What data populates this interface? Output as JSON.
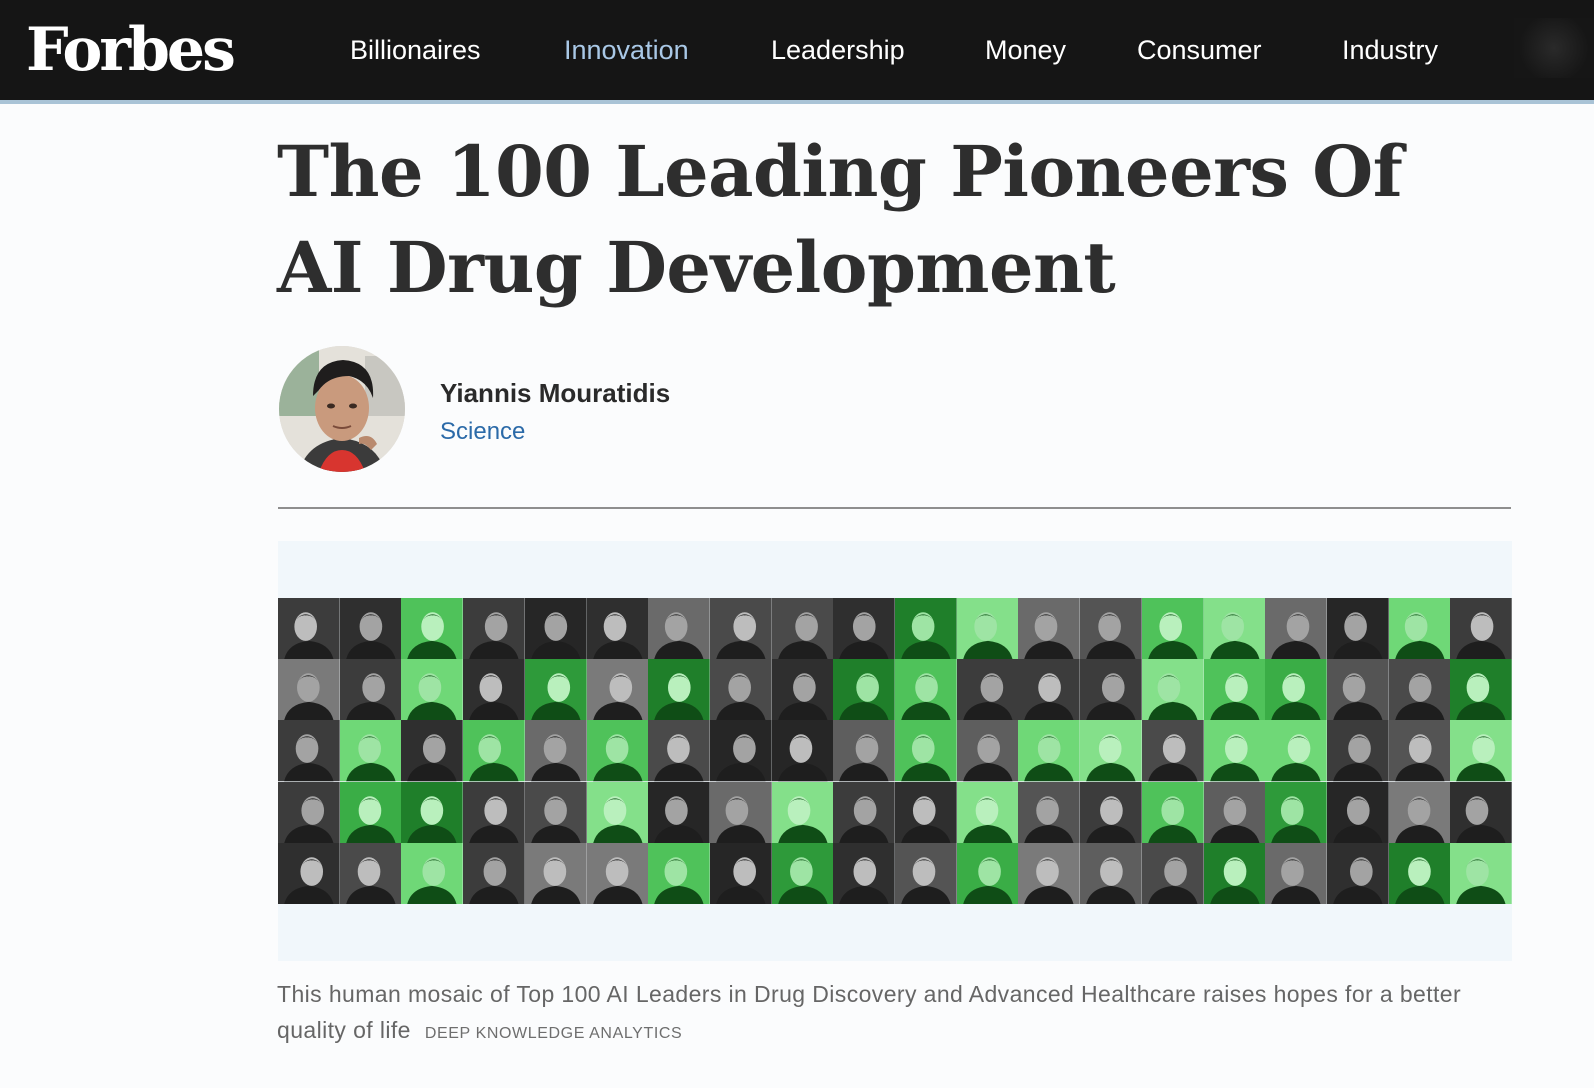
{
  "header": {
    "logo": "Forbes",
    "nav": [
      {
        "label": "Billionaires",
        "active": false
      },
      {
        "label": "Innovation",
        "active": true
      },
      {
        "label": "Leadership",
        "active": false
      },
      {
        "label": "Money",
        "active": false
      },
      {
        "label": "Consumer",
        "active": false
      },
      {
        "label": "Industry",
        "active": false
      }
    ]
  },
  "article": {
    "title": "The 100 Leading Pioneers Of AI Drug Development",
    "author": {
      "name": "Yiannis Mouratidis",
      "section": "Science"
    },
    "image": {
      "caption": "This human mosaic of Top 100 AI Leaders in Drug Discovery and Advanced Healthcare raises hopes for a better quality of life",
      "credit": "DEEP KNOWLEDGE ANALYTICS"
    }
  },
  "colors": {
    "nav_bg": "#151515",
    "nav_active": "#a9c8e6",
    "section_link": "#2b6aa8",
    "mosaic_green": "#39b54a"
  }
}
